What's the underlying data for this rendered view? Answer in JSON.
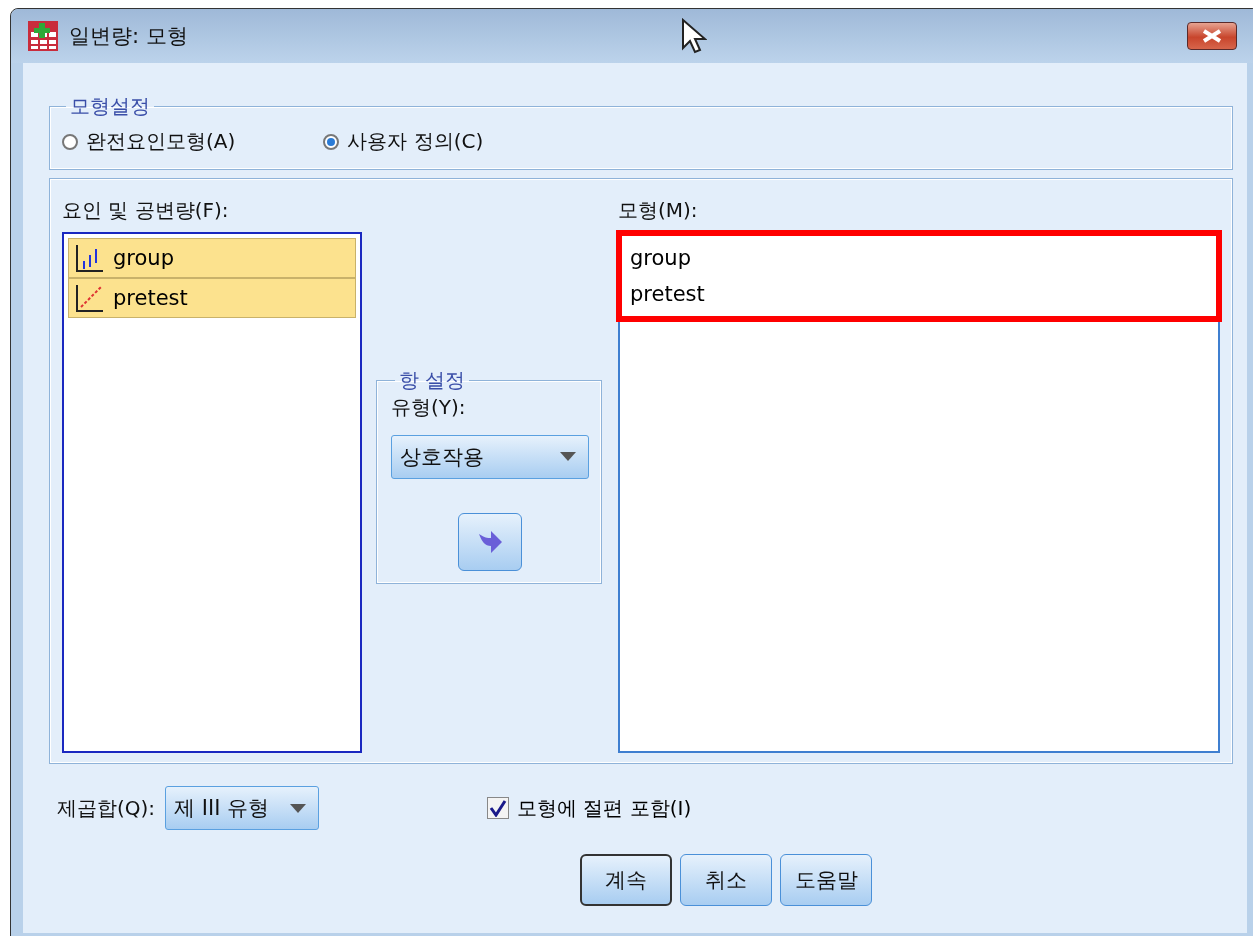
{
  "window": {
    "title": "일변량: 모형"
  },
  "model_setting": {
    "title": "모형설정",
    "options": [
      {
        "label": "완전요인모형(A)",
        "selected": false
      },
      {
        "label": "사용자 정의(C)",
        "selected": true
      }
    ]
  },
  "factors": {
    "label": "요인 및 공변량(F):",
    "items": [
      {
        "name": "group",
        "kind": "nominal",
        "selected": true
      },
      {
        "name": "pretest",
        "kind": "scale",
        "selected": true
      }
    ]
  },
  "build_term": {
    "title": "항 설정",
    "type_label": "유형(Y):",
    "type_value": "상호작용"
  },
  "model": {
    "label": "모형(M):",
    "items": [
      {
        "name": "group",
        "highlighted": true
      },
      {
        "name": "pretest",
        "highlighted": true
      }
    ]
  },
  "sum_of_squares": {
    "label": "제곱합(Q):",
    "value": "제 III 유형"
  },
  "intercept": {
    "label": "모형에 절편 포함(I)",
    "checked": true
  },
  "buttons": [
    {
      "label": "계속",
      "default": true
    },
    {
      "label": "취소",
      "default": false
    },
    {
      "label": "도움말",
      "default": false
    }
  ]
}
